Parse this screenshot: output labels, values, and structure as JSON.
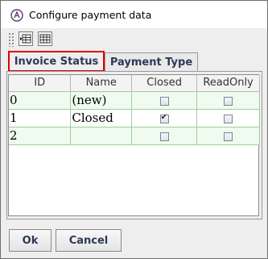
{
  "window": {
    "title": "Configure payment data"
  },
  "toolbar": {
    "buttons": [
      {
        "icon": "insert-row-icon"
      },
      {
        "icon": "table-grid-icon"
      }
    ]
  },
  "tabs": [
    {
      "label": "Invoice Status",
      "active": true
    },
    {
      "label": "Payment Type",
      "active": false
    }
  ],
  "table": {
    "columns": [
      "ID",
      "Name",
      "Closed",
      "ReadOnly"
    ],
    "rows": [
      {
        "id": "0",
        "name": "(new)",
        "closed": false,
        "readonly": false
      },
      {
        "id": "1",
        "name": "Closed",
        "closed": true,
        "readonly": false
      },
      {
        "id": "2",
        "name": "",
        "closed": false,
        "readonly": false
      }
    ]
  },
  "buttons": {
    "ok": "Ok",
    "cancel": "Cancel"
  },
  "colors": {
    "active_tab_border": "#e00000",
    "row_grid": "#9fce9f",
    "alt_row": "#eefbee"
  }
}
